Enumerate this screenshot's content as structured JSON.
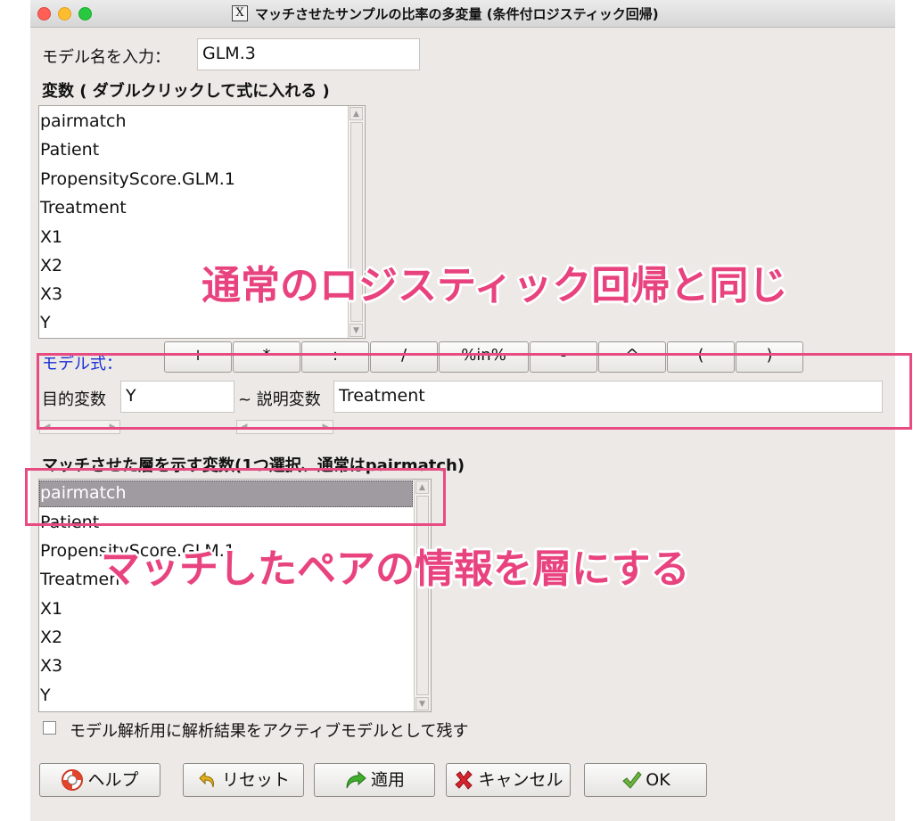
{
  "window": {
    "title": "マッチさせたサンプルの比率の多変量 (条件付ロジスティック回帰)",
    "app_icon": "x11-icon"
  },
  "model_name": {
    "label": "モデル名を入力：",
    "value": "GLM.3"
  },
  "variables": {
    "label": "変数 ( ダブルクリックして式に入れる )",
    "items": [
      "pairmatch",
      "Patient",
      "PropensityScore.GLM.1",
      "Treatment",
      "X1",
      "X2",
      "X3",
      "Y"
    ]
  },
  "formula": {
    "label": "モデル式：",
    "operators": [
      "+",
      "*",
      ":",
      "/",
      "%in%",
      "-",
      "^",
      "(",
      ")"
    ],
    "lhs_label": "目的変数",
    "lhs_value": "Y",
    "rhs_label": "~ 説明変数",
    "rhs_value": "Treatment"
  },
  "strata": {
    "label": "マッチさせた層を示す変数(1つ選択、通常はpairmatch)",
    "items": [
      "pairmatch",
      "Patient",
      "PropensityScore.GLM.1",
      "Treatment",
      "X1",
      "X2",
      "X3",
      "Y"
    ],
    "selected": "pairmatch"
  },
  "keep_model": {
    "label": "モデル解析用に解析結果をアクティブモデルとして残す",
    "checked": false
  },
  "buttons": {
    "help": "ヘルプ",
    "reset": "リセット",
    "apply": "適用",
    "cancel": "キャンセル",
    "ok": "OK"
  },
  "annotations": {
    "formula_note": "通常のロジスティック回帰と同じ",
    "strata_note": "マッチしたペアの情報を層にする",
    "color": "#e84b82"
  },
  "colors": {
    "selection": "#a09ba0",
    "formula_label": "#1a2fd6"
  }
}
